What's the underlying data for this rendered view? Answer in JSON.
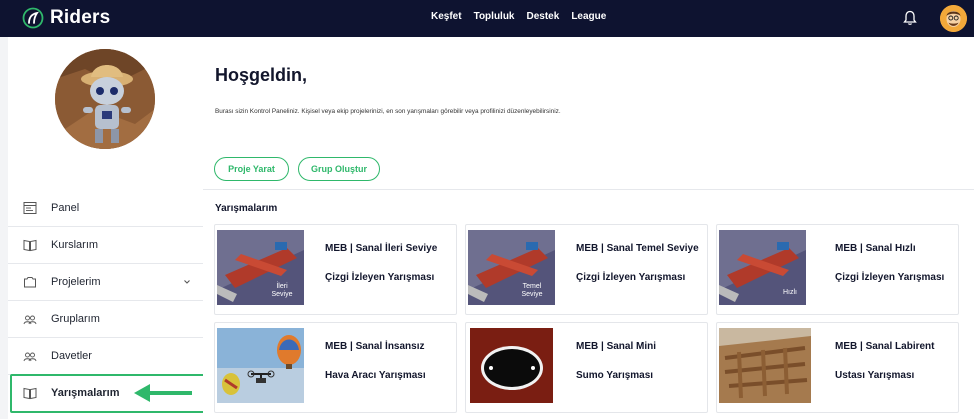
{
  "app": {
    "name": "Riders"
  },
  "nav": {
    "items": [
      "Keşfet",
      "Topluluk",
      "Destek",
      "League"
    ]
  },
  "sidebar": {
    "items": [
      {
        "label": "Panel",
        "icon": "panel-icon"
      },
      {
        "label": "Kurslarım",
        "icon": "book-icon"
      },
      {
        "label": "Projelerim",
        "icon": "project-icon",
        "has_dropdown": true
      },
      {
        "label": "Gruplarım",
        "icon": "group-icon"
      },
      {
        "label": "Davetler",
        "icon": "invite-icon"
      },
      {
        "label": "Yarışmalarım",
        "icon": "competition-icon",
        "active": true
      }
    ]
  },
  "main": {
    "title": "Hoşgeldin,",
    "subtitle": "Burası sizin Kontrol Paneliniz. Kişisel veya ekip projelerinizi, en son yarışmaları görebilir veya profilinizi düzenleyebilirsiniz.",
    "buttons": {
      "create_project": "Proje Yarat",
      "create_group": "Grup Oluştur"
    },
    "section_title": "Yarışmalarım",
    "cards": [
      {
        "line1": "MEB | Sanal İleri Seviye",
        "line2": "Çizgi İzleyen Yarışması",
        "thumb_caption": "İleri Seviye"
      },
      {
        "line1": "MEB | Sanal Temel Seviye",
        "line2": "Çizgi İzleyen Yarışması",
        "thumb_caption": "Temel Seviye"
      },
      {
        "line1": "MEB | Sanal Hızlı",
        "line2": "Çizgi İzleyen Yarışması",
        "thumb_caption": "Hızlı"
      },
      {
        "line1": "MEB | Sanal İnsansız",
        "line2": "Hava Aracı Yarışması",
        "thumb_caption": ""
      },
      {
        "line1": "MEB | Sanal Mini",
        "line2": "Sumo Yarışması",
        "thumb_caption": ""
      },
      {
        "line1": "MEB | Sanal Labirent",
        "line2": "Ustası Yarışması",
        "thumb_caption": ""
      }
    ]
  },
  "colors": {
    "navbar": "#0e1330",
    "accent_green": "#2fb86b",
    "text_dark": "#12162c"
  }
}
